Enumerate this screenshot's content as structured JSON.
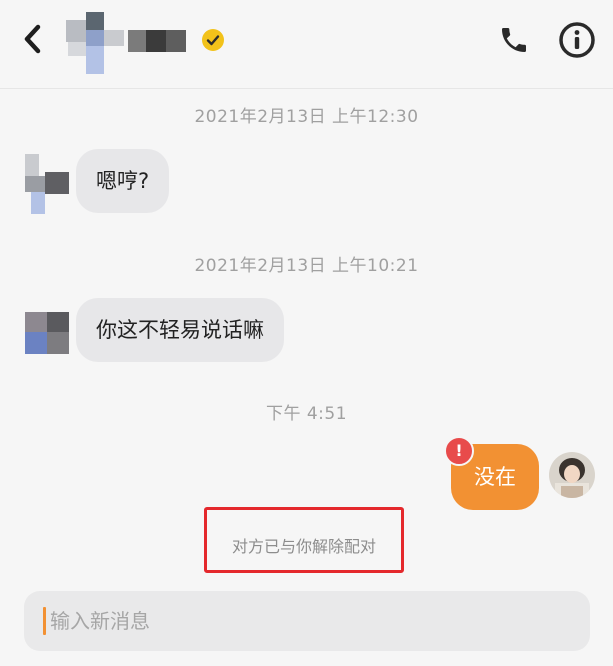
{
  "header": {
    "back_icon": "chevron-left-icon",
    "verified_icon": "verified-check-icon",
    "phone_icon": "phone-icon",
    "info_icon": "info-icon",
    "accent_color": "#f2c21a"
  },
  "messages": [
    {
      "type": "timestamp",
      "text": "2021年2月13日 上午12:30"
    },
    {
      "type": "incoming",
      "text": "嗯哼?"
    },
    {
      "type": "timestamp",
      "text": "2021年2月13日 上午10:21"
    },
    {
      "type": "incoming",
      "text": "你这不轻易说话嘛"
    },
    {
      "type": "timestamp",
      "text": "下午 4:51"
    },
    {
      "type": "outgoing",
      "text": "没在",
      "status": "failed",
      "status_glyph": "!"
    }
  ],
  "notice": {
    "text": "对方已与你解除配对"
  },
  "composer": {
    "placeholder": "输入新消息"
  },
  "colors": {
    "outgoing_bubble": "#f29133",
    "incoming_bubble": "#e7e7e9",
    "error_badge": "#e84b4b",
    "highlight_box": "#e4282c"
  }
}
